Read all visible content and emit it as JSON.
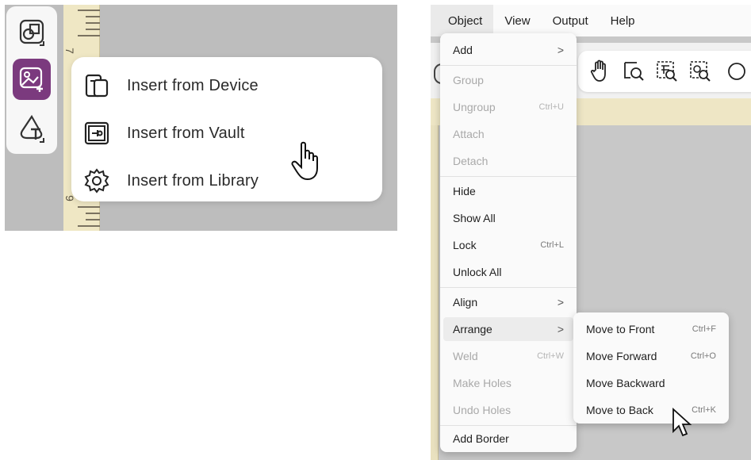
{
  "left_panel": {
    "ruler_numbers": [
      "7",
      "9"
    ],
    "toolbar": {
      "items": [
        {
          "icon": "shapes-icon"
        },
        {
          "icon": "insert-image-icon",
          "active": true
        },
        {
          "icon": "text-shape-icon"
        }
      ]
    },
    "insert_menu": {
      "items": [
        {
          "icon": "device-icon",
          "label": "Insert from Device"
        },
        {
          "icon": "vault-icon",
          "label": "Insert from Vault"
        },
        {
          "icon": "gear-icon",
          "label": "Insert from Library"
        }
      ]
    },
    "accent_color": "#7b3a7e"
  },
  "right_panel": {
    "menubar": {
      "items": [
        "Object",
        "View",
        "Output",
        "Help"
      ],
      "open": "Object"
    },
    "toolbar_icons": [
      "hand-icon",
      "zoom-page-icon",
      "zoom-selection-icon",
      "zoom-object-icon"
    ],
    "object_menu": {
      "add": {
        "label": "Add",
        "chevron": ">"
      },
      "group": {
        "label": "Group"
      },
      "ungroup": {
        "label": "Ungroup",
        "shortcut": "Ctrl+U"
      },
      "attach": {
        "label": "Attach"
      },
      "detach": {
        "label": "Detach"
      },
      "hide": {
        "label": "Hide"
      },
      "show_all": {
        "label": "Show All"
      },
      "lock": {
        "label": "Lock",
        "shortcut": "Ctrl+L"
      },
      "unlock_all": {
        "label": "Unlock All"
      },
      "align": {
        "label": "Align",
        "chevron": ">"
      },
      "arrange": {
        "label": "Arrange",
        "chevron": ">"
      },
      "weld": {
        "label": "Weld",
        "shortcut": "Ctrl+W"
      },
      "make_holes": {
        "label": "Make Holes"
      },
      "undo_holes": {
        "label": "Undo Holes"
      },
      "add_border": {
        "label": "Add Border"
      }
    },
    "arrange_submenu": {
      "move_to_front": {
        "label": "Move to Front",
        "shortcut": "Ctrl+F"
      },
      "move_forward": {
        "label": "Move Forward",
        "shortcut": "Ctrl+O"
      },
      "move_backward": {
        "label": "Move Backward"
      },
      "move_to_back": {
        "label": "Move to Back",
        "shortcut": "Ctrl+K"
      }
    }
  }
}
